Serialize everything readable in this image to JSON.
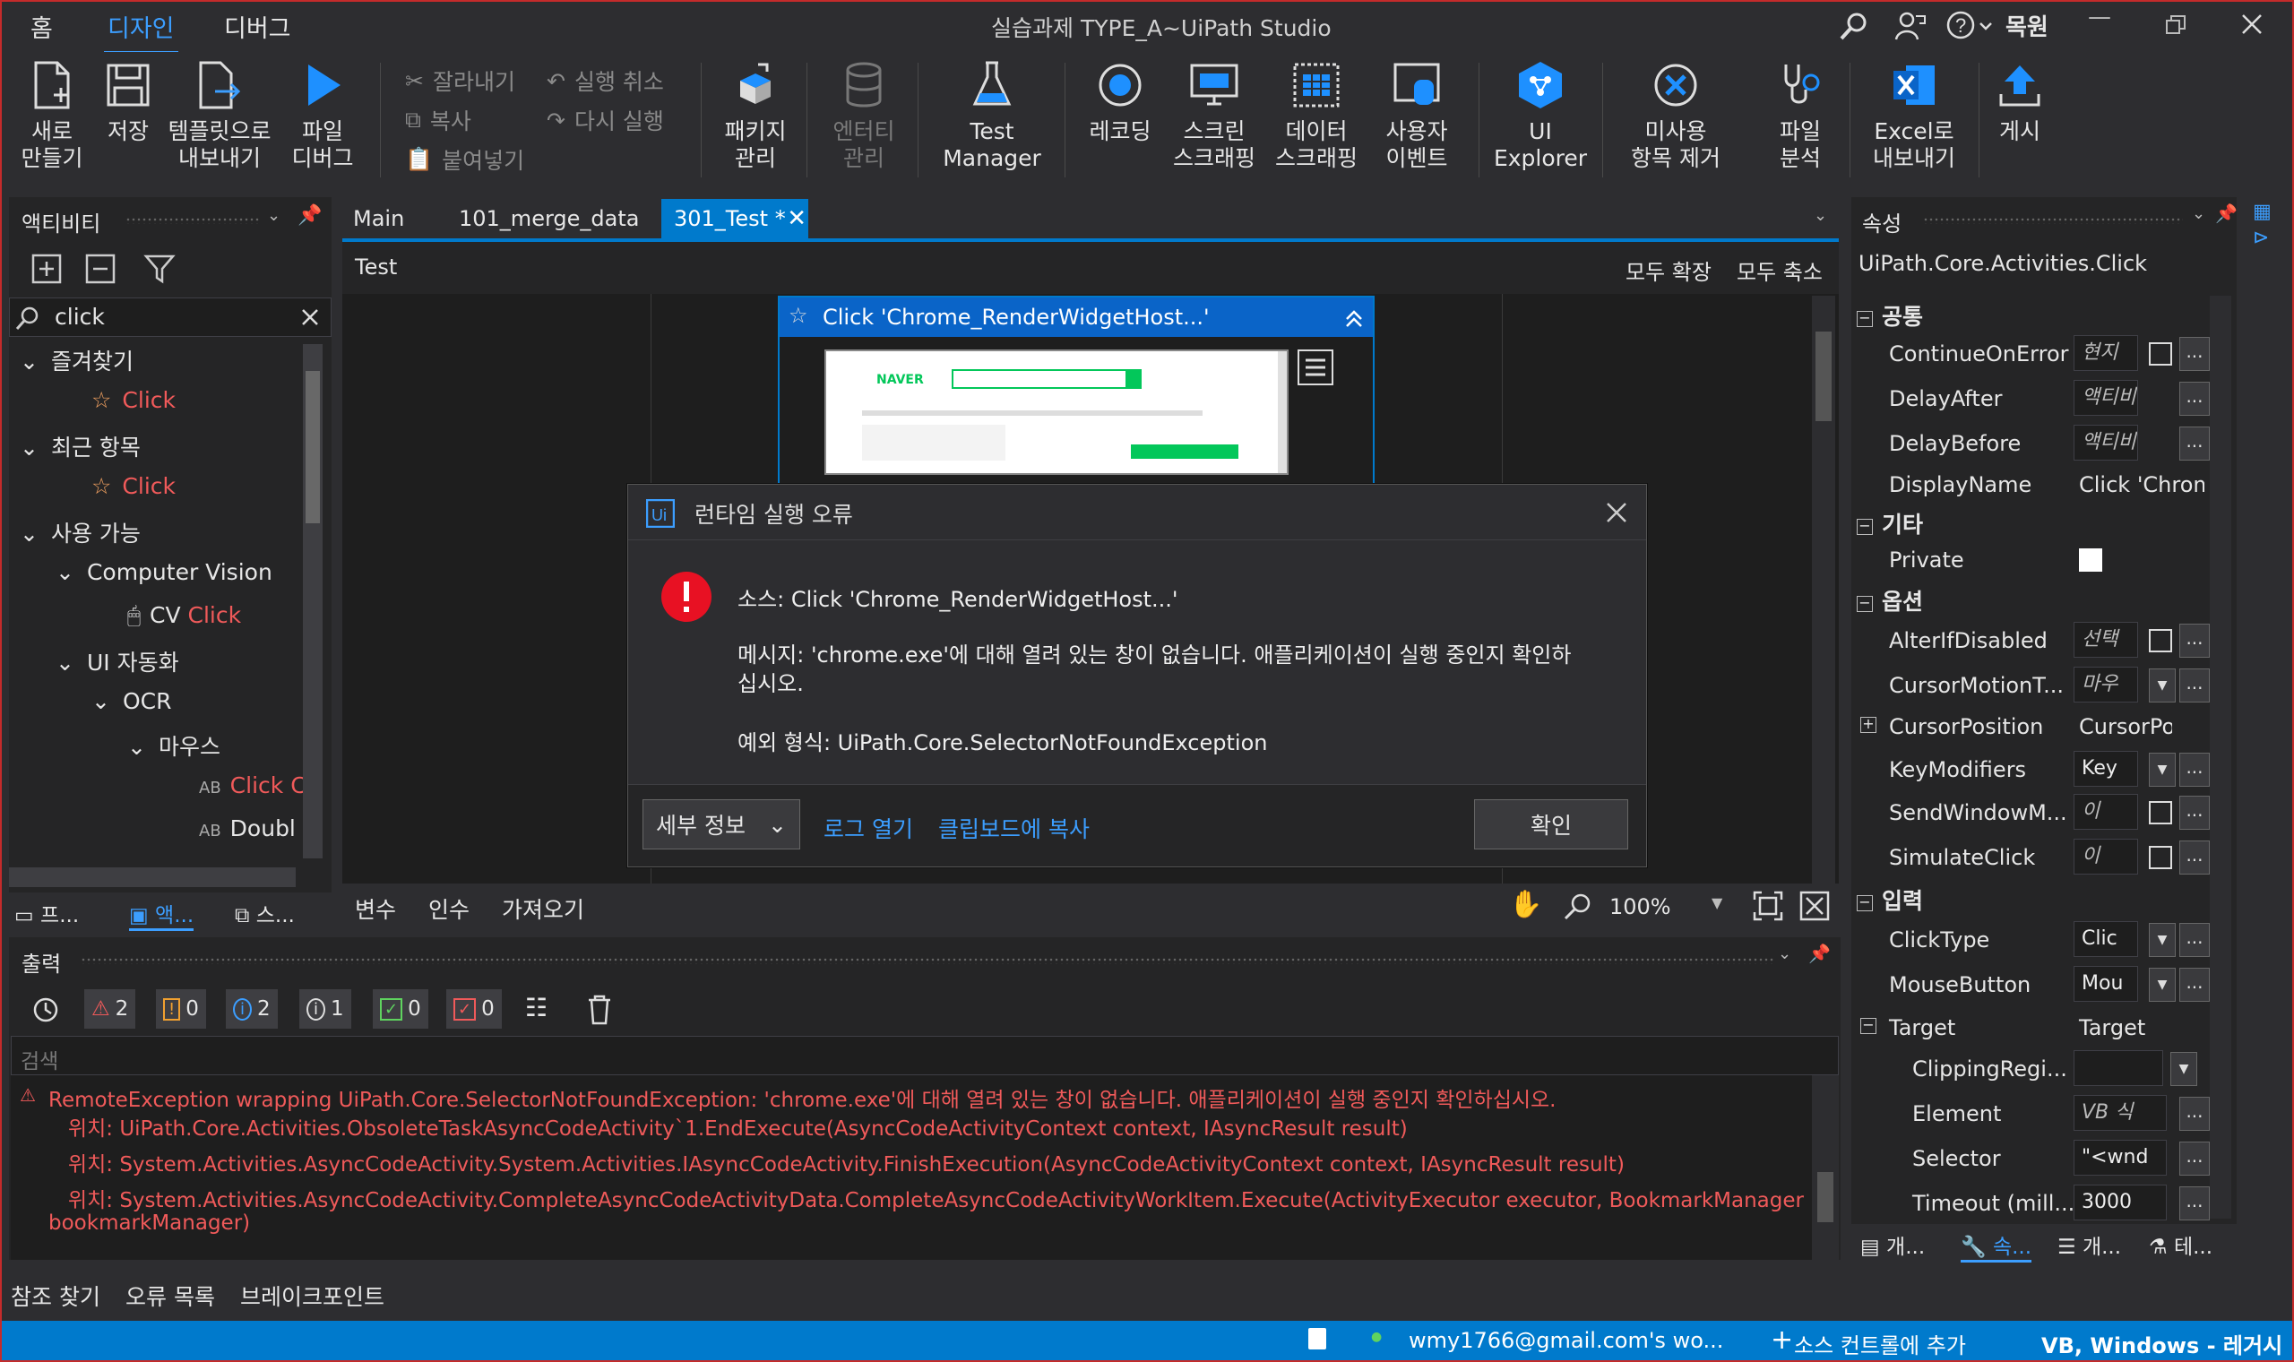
{
  "titlebar": {
    "tabs": [
      "홈",
      "디자인",
      "디버그"
    ],
    "title": "실습과제 TYPE_A~UiPath Studio",
    "user": "목원"
  },
  "ribbon": {
    "new": "새로\n만들기",
    "save": "저장",
    "export_template": "템플릿으로\n내보내기",
    "debug_file": "파일\n디버그",
    "cut": "잘라내기",
    "copy": "복사",
    "paste": "붙여넣기",
    "undo": "실행 취소",
    "redo": "다시 실행",
    "manage_packages": "패키지\n관리",
    "entities": "엔터티\n관리",
    "test_manager": "Test\nManager",
    "recording": "레코딩",
    "screen_scraping": "스크린\n스크래핑",
    "data_scraping": "데이터\n스크래핑",
    "user_events": "사용자\n이벤트",
    "ui_explorer": "UI\nExplorer",
    "remove_unused": "미사용\n항목 제거",
    "file_analysis": "파일\n분석",
    "export_excel": "Excel로\n내보내기",
    "publish": "게시"
  },
  "activities": {
    "title": "액티비티",
    "search_value": "click",
    "favorites": "즐겨찾기",
    "fav_click": "Click",
    "recent": "최근 항목",
    "recent_click": "Click",
    "available": "사용 가능",
    "computer_vision": "Computer Vision",
    "cv_prefix": "CV ",
    "cv_click": "Click",
    "ui_automation": "UI 자동화",
    "ocr": "OCR",
    "mouse": "마우스",
    "click_c": "Click C",
    "double": "Doubl",
    "bottom_tabs": [
      "프...",
      "액...",
      "스..."
    ]
  },
  "doc": {
    "tabs": [
      "Main",
      "101_merge_data",
      "301_Test *"
    ],
    "breadcrumb": "Test",
    "expand_all": "모두 확장",
    "collapse_all": "모두 축소",
    "activity_title": "Click 'Chrome_RenderWidgetHost...'",
    "naver": "NAVER",
    "bottom": {
      "variables": "변수",
      "arguments": "인수",
      "imports": "가져오기",
      "zoom": "100%"
    }
  },
  "dialog": {
    "title": "런타임 실행 오류",
    "source": "소스: Click 'Chrome_RenderWidgetHost...'",
    "message_1": "메시지: 'chrome.exe'에 대해 열려 있는 창이 없습니다. 애플리케이션이 실행 중인지 확인하",
    "message_2": "십시오.",
    "exception": "예외 형식: UiPath.Core.SelectorNotFoundException",
    "details": "세부 정보",
    "open_logs": "로그 열기",
    "copy_clipboard": "클립보드에 복사",
    "ok": "확인"
  },
  "properties": {
    "title": "속성",
    "type": "UiPath.Core.Activities.Click",
    "cat_common": "공통",
    "cat_misc": "기타",
    "cat_options": "옵션",
    "cat_input": "입력",
    "rows": [
      {
        "name": "ContinueOnError",
        "val": "현지"
      },
      {
        "name": "DelayAfter",
        "val": "액티비티"
      },
      {
        "name": "DelayBefore",
        "val": "액티비티"
      },
      {
        "name": "DisplayName",
        "val": "Click 'Chrom"
      },
      {
        "name": "Private",
        "val": ""
      },
      {
        "name": "AlterIfDisabled",
        "val": "선택"
      },
      {
        "name": "CursorMotionT...",
        "val": "마우"
      },
      {
        "name": "CursorPosition",
        "val": "CursorPos"
      },
      {
        "name": "KeyModifiers",
        "val": "Key"
      },
      {
        "name": "SendWindowM...",
        "val": "이"
      },
      {
        "name": "SimulateClick",
        "val": "이"
      },
      {
        "name": "ClickType",
        "val": "Clic"
      },
      {
        "name": "MouseButton",
        "val": "Mou"
      },
      {
        "name": "Target",
        "val": "Target"
      },
      {
        "name": "ClippingRegi...",
        "val": ""
      },
      {
        "name": "Element",
        "val": "VB 식"
      },
      {
        "name": "Selector",
        "val": "\"<wnd"
      },
      {
        "name": "Timeout (mill...",
        "val": "3000"
      }
    ],
    "bottom_tabs": [
      "개...",
      "속...",
      "개...",
      "테..."
    ]
  },
  "output": {
    "title": "출력",
    "counts": {
      "warn": "2",
      "warn2": "0",
      "info": "2",
      "info2": "1",
      "ok": "0",
      "err": "0"
    },
    "search_placeholder": "검색",
    "lines": [
      "RemoteException wrapping UiPath.Core.SelectorNotFoundException: 'chrome.exe'에 대해 열려 있는 창이 없습니다. 애플리케이션이 실행 중인지 확인하십시오.",
      "   위치: UiPath.Core.Activities.ObsoleteTaskAsyncCodeActivity`1.EndExecute(AsyncCodeActivityContext context, IAsyncResult result)",
      "   위치: System.Activities.AsyncCodeActivity.System.Activities.IAsyncCodeActivity.FinishExecution(AsyncCodeActivityContext context, IAsyncResult result)",
      "   위치: System.Activities.AsyncCodeActivity.CompleteAsyncCodeActivityData.CompleteAsyncCodeActivityWorkItem.Execute(ActivityExecutor executor, BookmarkManager",
      "bookmarkManager)"
    ]
  },
  "bottom_tabs": [
    "참조 찾기",
    "오류 목록",
    "브레이크포인트"
  ],
  "statusbar": {
    "account": "wmy1766@gmail.com's wo...",
    "source_control": "소스 컨트롤에 추가",
    "language": "VB, Windows - 레거시"
  }
}
